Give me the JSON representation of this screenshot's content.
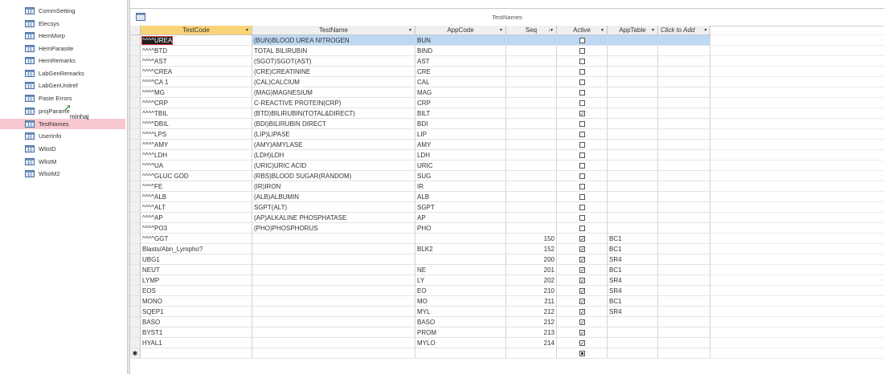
{
  "navigation": {
    "items": [
      {
        "label": "CommSetting",
        "selected": false
      },
      {
        "label": "Elecsys",
        "selected": false
      },
      {
        "label": "HemMorp",
        "selected": false
      },
      {
        "label": "HemParasite",
        "selected": false
      },
      {
        "label": "HemRemarks",
        "selected": false
      },
      {
        "label": "LabGenRemarks",
        "selected": false
      },
      {
        "label": "LabGenUnitref",
        "selected": false
      },
      {
        "label": "Paste Errors",
        "selected": false
      },
      {
        "label": "projParame",
        "selected": false
      },
      {
        "label": "TestNames",
        "selected": true
      },
      {
        "label": "UserInfo",
        "selected": false
      },
      {
        "label": "WlistD",
        "selected": false
      },
      {
        "label": "WlistM",
        "selected": false
      },
      {
        "label": "WlistM2",
        "selected": false
      }
    ],
    "drag_tooltip": "minhaj",
    "icon": "table-icon"
  },
  "document": {
    "title": "TestNames",
    "icon": "table-icon"
  },
  "grid": {
    "columns": [
      {
        "key": "test_code",
        "label": "TestCode",
        "sort": "▾"
      },
      {
        "key": "test_name",
        "label": "TestName",
        "sort": "▾"
      },
      {
        "key": "app_code",
        "label": "AppCode",
        "sort": "▾"
      },
      {
        "key": "seq",
        "label": "Seq",
        "sort": "↓▾"
      },
      {
        "key": "active",
        "label": "Active",
        "sort": "▾"
      },
      {
        "key": "app_table",
        "label": "AppTable",
        "sort": "▾"
      },
      {
        "key": "add",
        "label": "Click to Add",
        "sort": "▾"
      }
    ],
    "rows": [
      {
        "test_code": "^^^^UREA",
        "test_name": "(BUN)BLOOD UREA NITROGEN",
        "app_code": "BUN",
        "seq": "",
        "active": false,
        "app_table": ""
      },
      {
        "test_code": "^^^^BTD",
        "test_name": "TOTAL BILIRUBIN",
        "app_code": "BIND",
        "seq": "",
        "active": false,
        "app_table": ""
      },
      {
        "test_code": "^^^^AST",
        "test_name": "(SGOT)SGOT(AST)",
        "app_code": "AST",
        "seq": "",
        "active": false,
        "app_table": ""
      },
      {
        "test_code": "^^^^CREA",
        "test_name": "(CRE)CREATININE",
        "app_code": "CRE",
        "seq": "",
        "active": false,
        "app_table": ""
      },
      {
        "test_code": "^^^^CA 1",
        "test_name": "(CAL)CALCIUM",
        "app_code": "CAL",
        "seq": "",
        "active": false,
        "app_table": ""
      },
      {
        "test_code": "^^^^MG",
        "test_name": "(MAG)MAGNESIUM",
        "app_code": "MAG",
        "seq": "",
        "active": false,
        "app_table": ""
      },
      {
        "test_code": "^^^^CRP",
        "test_name": "C-REACTIVE PROTEIN(CRP)",
        "app_code": "CRP",
        "seq": "",
        "active": false,
        "app_table": ""
      },
      {
        "test_code": "^^^^TBIL",
        "test_name": "(BTD)BILIRUBIN(TOTAL&DIRECT)",
        "app_code": "BILT",
        "seq": "",
        "active": true,
        "app_table": ""
      },
      {
        "test_code": "^^^^DBIL",
        "test_name": "(BDI)BILIRUBIN DIRECT",
        "app_code": "BDI",
        "seq": "",
        "active": false,
        "app_table": ""
      },
      {
        "test_code": "^^^^LPS",
        "test_name": "(LIP)LIPASE",
        "app_code": "LIP",
        "seq": "",
        "active": false,
        "app_table": ""
      },
      {
        "test_code": "^^^^AMY",
        "test_name": "(AMY)AMYLASE",
        "app_code": "AMY",
        "seq": "",
        "active": false,
        "app_table": ""
      },
      {
        "test_code": "^^^^LDH",
        "test_name": "(LDH)LDH",
        "app_code": "LDH",
        "seq": "",
        "active": false,
        "app_table": ""
      },
      {
        "test_code": "^^^^UA",
        "test_name": "(URIC)URIC ACID",
        "app_code": "URIC",
        "seq": "",
        "active": false,
        "app_table": ""
      },
      {
        "test_code": "^^^^GLUC GOD",
        "test_name": "(RBS)BLOOD SUGAR(RANDOM)",
        "app_code": "SUG",
        "seq": "",
        "active": false,
        "app_table": ""
      },
      {
        "test_code": "^^^^FE",
        "test_name": "(IR)IRON",
        "app_code": "IR",
        "seq": "",
        "active": false,
        "app_table": ""
      },
      {
        "test_code": "^^^^ALB",
        "test_name": "(ALB)ALBUMIN",
        "app_code": "ALB",
        "seq": "",
        "active": false,
        "app_table": ""
      },
      {
        "test_code": "^^^^ALT",
        "test_name": "SGPT(ALT)",
        "app_code": "SGPT",
        "seq": "",
        "active": false,
        "app_table": ""
      },
      {
        "test_code": "^^^^AP",
        "test_name": "(AP)ALKALINE PHOSPHATASE",
        "app_code": "AP",
        "seq": "",
        "active": false,
        "app_table": ""
      },
      {
        "test_code": "^^^^PO3",
        "test_name": "(PHO)PHOSPHORUS",
        "app_code": "PHO",
        "seq": "",
        "active": false,
        "app_table": ""
      },
      {
        "test_code": "^^^^GGT",
        "test_name": "",
        "app_code": "",
        "seq": "150",
        "active": true,
        "app_table": "BC1"
      },
      {
        "test_code": "Blasts/Abn_Lympho?",
        "test_name": "",
        "app_code": "BLK2",
        "seq": "152",
        "active": true,
        "app_table": "BC1"
      },
      {
        "test_code": "UBG1",
        "test_name": "",
        "app_code": "",
        "seq": "200",
        "active": true,
        "app_table": "SR4"
      },
      {
        "test_code": "NEUT",
        "test_name": "",
        "app_code": "NE",
        "seq": "201",
        "active": true,
        "app_table": "BC1"
      },
      {
        "test_code": "LYMP",
        "test_name": "",
        "app_code": "LY",
        "seq": "202",
        "active": true,
        "app_table": "SR4"
      },
      {
        "test_code": "EOS",
        "test_name": "",
        "app_code": "EO",
        "seq": "210",
        "active": true,
        "app_table": "SR4"
      },
      {
        "test_code": "MONO",
        "test_name": "",
        "app_code": "MO",
        "seq": "211",
        "active": true,
        "app_table": "BC1"
      },
      {
        "test_code": "SQEP1",
        "test_name": "",
        "app_code": "MYL",
        "seq": "212",
        "active": true,
        "app_table": "SR4"
      },
      {
        "test_code": "BASO",
        "test_name": "",
        "app_code": "BASO",
        "seq": "212",
        "active": true,
        "app_table": ""
      },
      {
        "test_code": "BYST1",
        "test_name": "",
        "app_code": "PROM",
        "seq": "213",
        "active": true,
        "app_table": ""
      },
      {
        "test_code": "HYAL1",
        "test_name": "",
        "app_code": "MYLO",
        "seq": "214",
        "active": true,
        "app_table": ""
      }
    ],
    "new_record_marker": "✱",
    "selected_row_index": 0,
    "colors": {
      "active_header": "#f9d479",
      "selected_row": "#bdd8f4",
      "selected_nav": "#f7c8ce"
    }
  }
}
